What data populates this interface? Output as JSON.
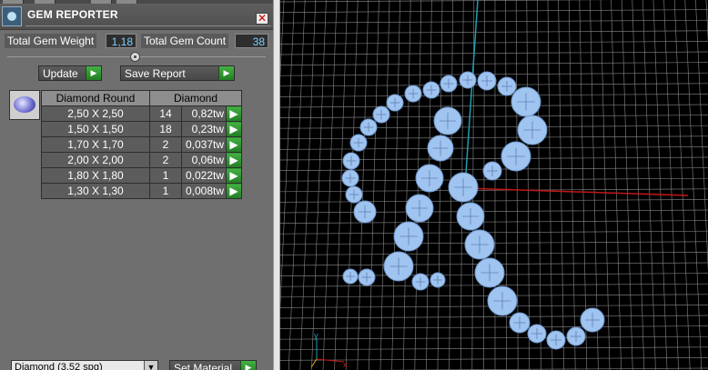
{
  "window": {
    "title": "GEM REPORTER",
    "close_glyph": "✕"
  },
  "stats": {
    "weight_label": "Total Gem Weight",
    "weight_value": "1,18",
    "count_label": "Total Gem Count",
    "count_value": "38"
  },
  "actions": {
    "update_label": "Update",
    "save_label": "Save Report",
    "arrow_glyph": "▶"
  },
  "table": {
    "headers": [
      "Diamond Round",
      "Diamond"
    ],
    "rows": [
      {
        "size": "2,50 X 2,50",
        "count": "14",
        "weight": "0,82tw"
      },
      {
        "size": "1,50 X 1,50",
        "count": "18",
        "weight": "0,23tw"
      },
      {
        "size": "1,70 X 1,70",
        "count": "2",
        "weight": "0,037tw"
      },
      {
        "size": "2,00 X 2,00",
        "count": "2",
        "weight": "0,06tw"
      },
      {
        "size": "1,80 X 1,80",
        "count": "1",
        "weight": "0,022tw"
      },
      {
        "size": "1,30 X 1,30",
        "count": "1",
        "weight": "0,008tw"
      }
    ]
  },
  "bottom": {
    "material_select": "Diamond    (3,52 spg)",
    "set_material_label": "Set Material",
    "dropdown_glyph": "▼"
  },
  "viewport": {
    "axis_y_label": "y",
    "axis_x_label": "x",
    "colors": {
      "background": "#000000",
      "grid": "#8a8a8a",
      "axis_vertical": "#1fa0b0",
      "axis_horizontal": "#c01818",
      "gem": "#9fc4f0"
    }
  }
}
